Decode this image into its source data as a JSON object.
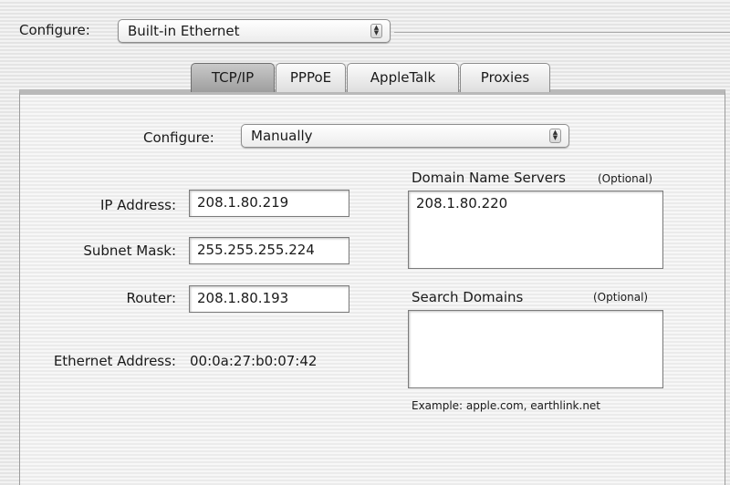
{
  "top": {
    "configure_label": "Configure:",
    "configure_value": "Built-in Ethernet"
  },
  "tabs": [
    {
      "label": "TCP/IP",
      "selected": true
    },
    {
      "label": "PPPoE",
      "selected": false
    },
    {
      "label": "AppleTalk",
      "selected": false
    },
    {
      "label": "Proxies",
      "selected": false
    }
  ],
  "tcpip": {
    "configure_label": "Configure:",
    "configure_value": "Manually",
    "ip_address_label": "IP Address:",
    "ip_address_value": "208.1.80.219",
    "subnet_mask_label": "Subnet Mask:",
    "subnet_mask_value": "255.255.255.224",
    "router_label": "Router:",
    "router_value": "208.1.80.193",
    "ethernet_address_label": "Ethernet Address:",
    "ethernet_address_value": "00:0a:27:b0:07:42",
    "dns_label": "Domain Name Servers",
    "dns_optional": "(Optional)",
    "dns_value": "208.1.80.220",
    "search_domains_label": "Search Domains",
    "search_domains_optional": "(Optional)",
    "search_domains_value": "",
    "example_text": "Example: apple.com, earthlink.net"
  },
  "icons": {
    "popup_arrows": "up-down-arrows-icon"
  }
}
